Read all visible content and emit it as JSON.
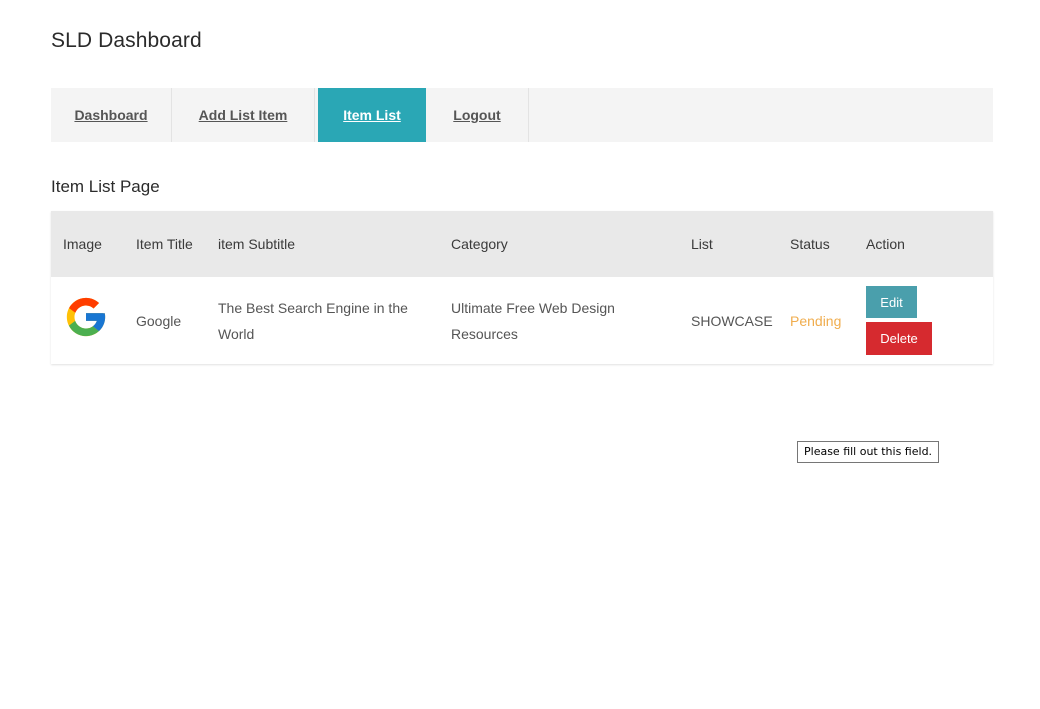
{
  "app": {
    "title": "SLD Dashboard"
  },
  "nav": {
    "items": [
      {
        "label": "Dashboard",
        "active": false
      },
      {
        "label": "Add List Item",
        "active": false
      },
      {
        "label": "Item List",
        "active": true
      },
      {
        "label": "Logout",
        "active": false
      }
    ]
  },
  "page": {
    "heading": "Item List Page"
  },
  "table": {
    "columns": [
      "Image",
      "Item Title",
      "item Subtitle",
      "Category",
      "List",
      "Status",
      "Action"
    ],
    "rows": [
      {
        "image_icon": "google-logo-icon",
        "title": "Google",
        "subtitle": "The Best Search Engine in the World",
        "category": "Ultimate Free Web Design Resources",
        "list": "SHOWCASE",
        "status": "Pending",
        "actions": {
          "edit_label": "Edit",
          "delete_label": "Delete"
        }
      }
    ]
  },
  "tooltip": {
    "text": "Please fill out this field."
  },
  "colors": {
    "accent": "#2aa7b5",
    "edit_button": "#4a9fac",
    "delete_button": "#d62a2f",
    "status_pending": "#f0ad4e",
    "header_bg": "#e9e9e9",
    "nav_bg": "#f4f4f4"
  }
}
